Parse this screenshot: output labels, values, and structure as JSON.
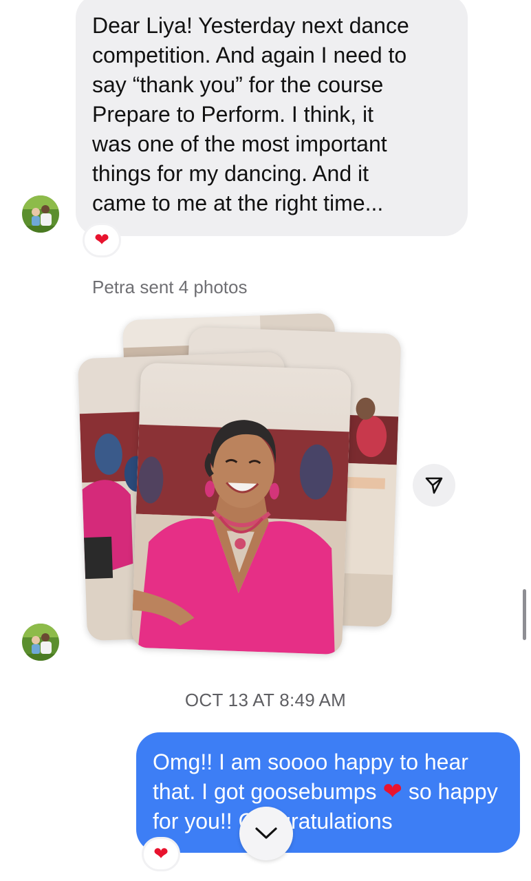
{
  "incoming_message": {
    "text": "Dear Liya! Yesterday next dance\ncompetition. And again I need to\nsay “thank you” for the course\nPrepare to Perform. I think, it\nwas one of the most important\nthings for my dancing. And it\ncame to me at the right time...",
    "reaction": "❤"
  },
  "photos_message": {
    "label": "Petra sent 4 photos",
    "photo_count": 4
  },
  "timestamp": "OCT 13 AT 8:49 AM",
  "outgoing_message": {
    "text_part1": "Omg!! I am soooo happy to hear that. I got goosebumps ",
    "inline_emoji": "❤",
    "text_part2": " so happy for you!! Congratulations",
    "reaction": "❤"
  },
  "icons": {
    "share": "send-paper-plane-icon",
    "scroll": "chevron-down-icon"
  },
  "colors": {
    "incoming_bubble": "#efeff1",
    "outgoing_bubble": "#3d7ef5",
    "heart": "#e8132e",
    "dress": "#e62f86"
  }
}
